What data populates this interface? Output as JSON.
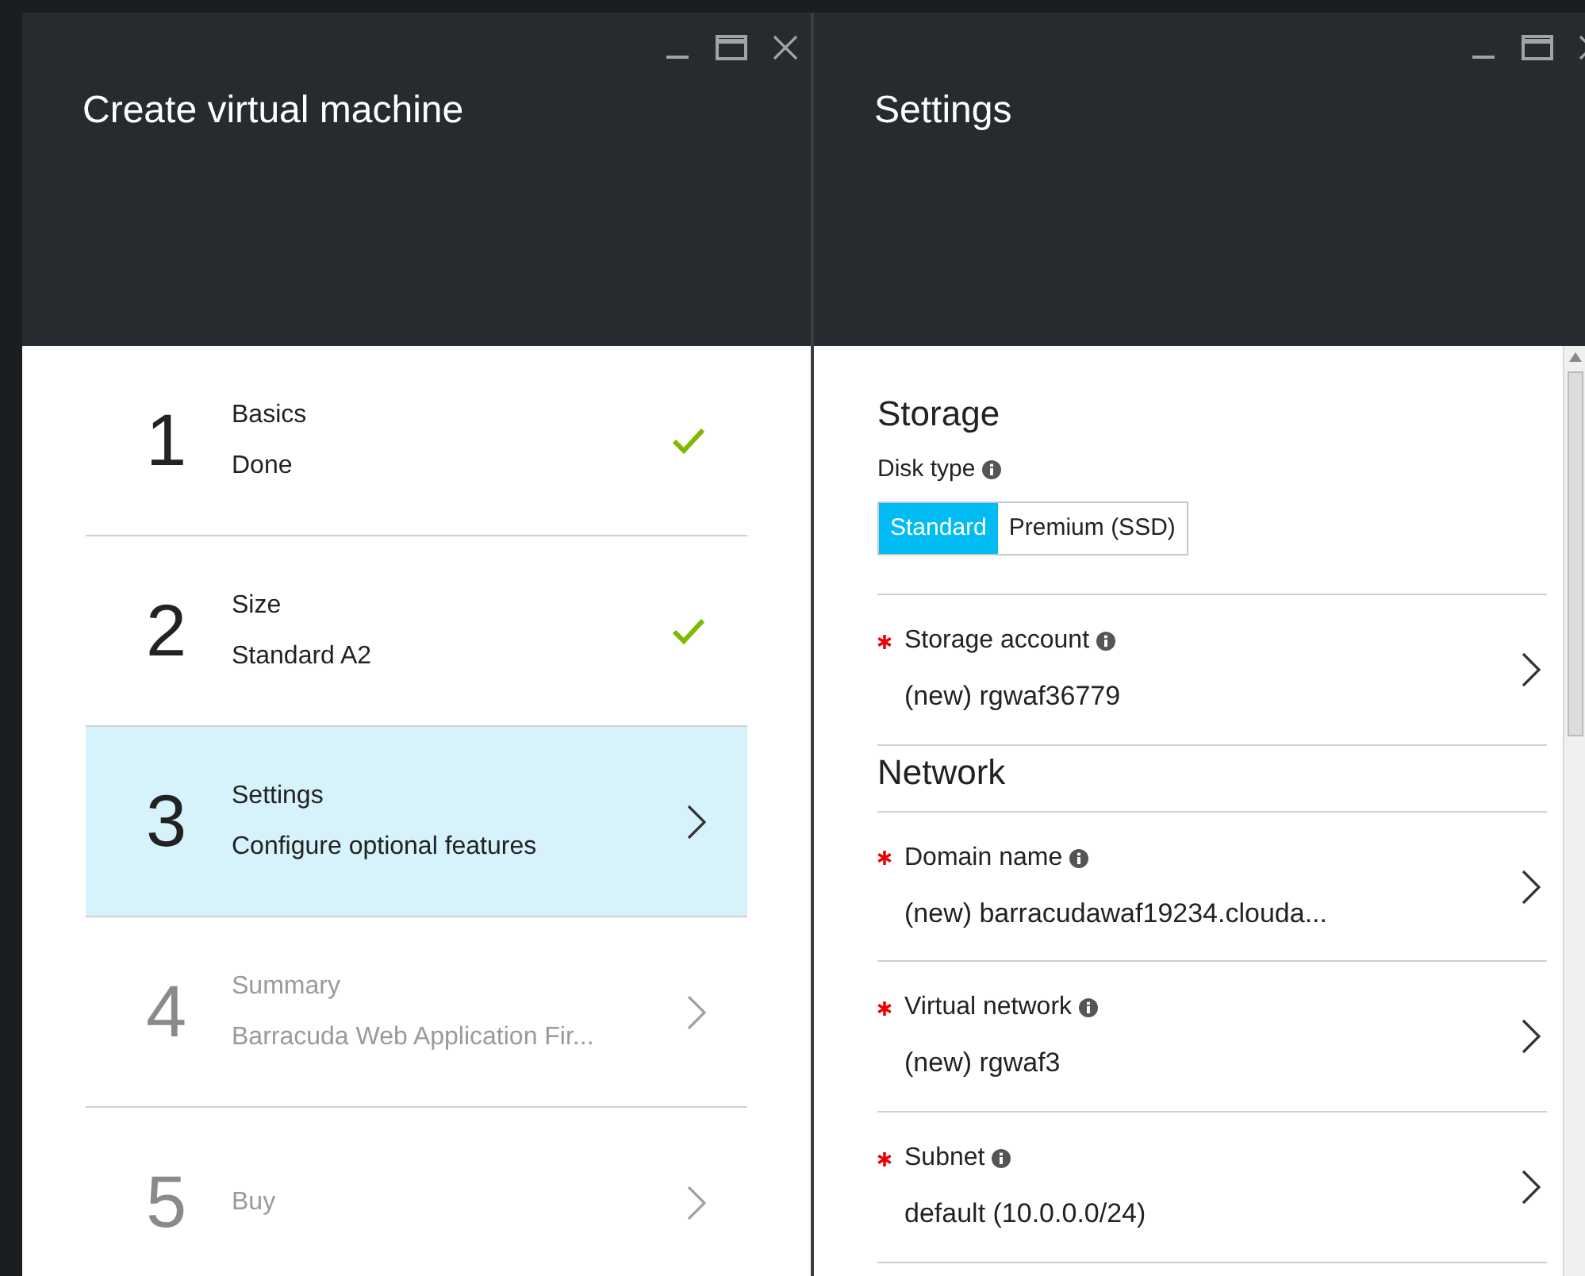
{
  "left_blade": {
    "title": "Create virtual machine",
    "steps": [
      {
        "number": "1",
        "title": "Basics",
        "subtitle": "Done",
        "done": true,
        "selected": false,
        "disabled": false
      },
      {
        "number": "2",
        "title": "Size",
        "subtitle": "Standard A2",
        "done": true,
        "selected": false,
        "disabled": false
      },
      {
        "number": "3",
        "title": "Settings",
        "subtitle": "Configure optional features",
        "done": false,
        "selected": true,
        "disabled": false
      },
      {
        "number": "4",
        "title": "Summary",
        "subtitle": "Barracuda Web Application Fir...",
        "done": false,
        "selected": false,
        "disabled": true
      },
      {
        "number": "5",
        "title": "Buy",
        "done": false,
        "selected": false,
        "disabled": true
      }
    ]
  },
  "right_blade": {
    "title": "Settings",
    "items": [
      {
        "kind": "heading",
        "text": "Storage"
      },
      {
        "kind": "toggle",
        "label": "Disk type",
        "options": [
          {
            "label": "Standard",
            "selected": true
          },
          {
            "label": "Premium (SSD)",
            "selected": false
          }
        ]
      },
      {
        "kind": "field",
        "required": true,
        "label": "Storage account",
        "value": "(new) rgwaf36779"
      },
      {
        "kind": "heading",
        "text": "Network"
      },
      {
        "kind": "field",
        "required": true,
        "label": "Domain name",
        "value": "(new) barracudawaf19234.clouda..."
      },
      {
        "kind": "field",
        "required": true,
        "label": "Virtual network",
        "value": "(new) rgwaf3"
      },
      {
        "kind": "field",
        "required": true,
        "label": "Subnet",
        "value": "default (10.0.0.0/24)"
      }
    ]
  }
}
